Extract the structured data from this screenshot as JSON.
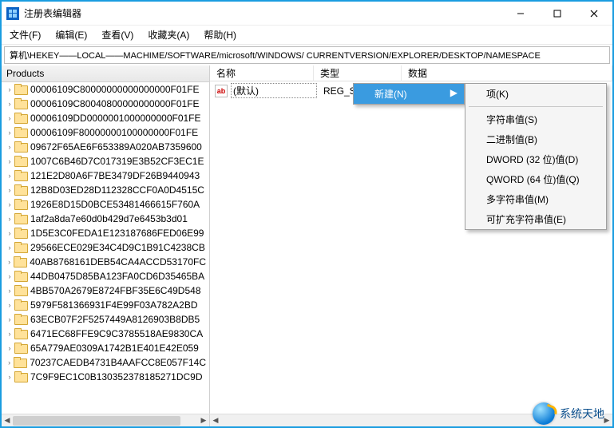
{
  "window": {
    "title": "注册表编辑器"
  },
  "menu": {
    "file": "文件(F)",
    "edit": "编辑(E)",
    "view": "查看(V)",
    "favorites": "收藏夹(A)",
    "help": "帮助(H)"
  },
  "address": "算机\\HEKEY——LOCAL——MACHIME/SOFTWARE/microsoft/WINDOWS/ CURRENTVERSION/EXPLORER/DESKTOP/NAMESPACE",
  "left_header": "Products",
  "tree_items": [
    "00006109C80000000000000000F01FE",
    "00006109C80040800000000000F01FE",
    "00006109DD0000001000000000F01FE",
    "00006109F80000000100000000F01FE",
    "09672F65AE6F653389A020AB7359600",
    "1007C6B46D7C017319E3B52CF3EC1E",
    "121E2D80A6F7BE3479DF26B9440943",
    "12B8D03ED28D112328CCF0A0D4515C",
    "1926E8D15D0BCE53481466615F760A",
    "1af2a8da7e60d0b429d7e6453b3d01",
    "1D5E3C0FEDA1E123187686FED06E99",
    "29566ECE029E34C4D9C1B91C4238CB",
    "40AB8768161DEB54CA4ACCD53170FC",
    "44DB0475D85BA123FA0CD6D35465BA",
    "4BB570A2679E8724FBF35E6C49D548",
    "5979F581366931F4E99F03A782A2BD",
    "63ECB07F2F5257449A8126903B8DB5",
    "6471EC68FFE9C9C3785518AE9830CA",
    "65A779AE0309A1742B1E401E42E059",
    "70237CAEDB4731B4AAFCC8E057F14C",
    "7C9F9EC1C0B130352378185271DC9D"
  ],
  "columns": {
    "name": "名称",
    "type": "类型",
    "data": "数据"
  },
  "value_row": {
    "name": "(默认)",
    "type": "REG_SZ",
    "icon_text": "ab"
  },
  "context": {
    "new": "新建(N)"
  },
  "submenu": {
    "key": "项(K)",
    "string": "字符串值(S)",
    "binary": "二进制值(B)",
    "dword": "DWORD (32 位)值(D)",
    "qword": "QWORD (64 位)值(Q)",
    "multi": "多字符串值(M)",
    "expand": "可扩充字符串值(E)"
  },
  "watermark": "系统天地"
}
